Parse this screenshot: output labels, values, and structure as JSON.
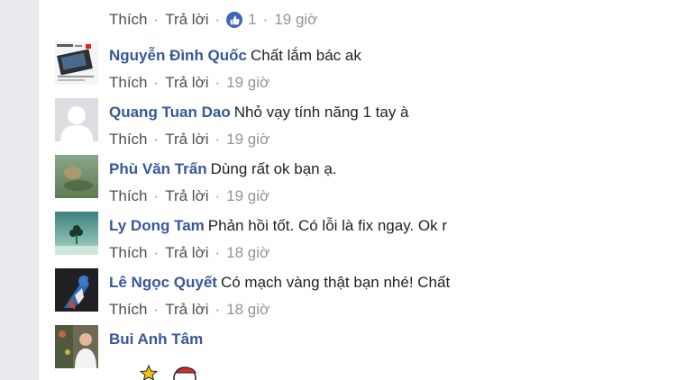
{
  "top": {
    "like_label": "Thích",
    "reply_label": "Trả lời",
    "like_count": "1",
    "time": "19 giờ"
  },
  "comments": [
    {
      "name": "Nguyễn Đình Quốc",
      "text": "Chất lắm bác ak",
      "like_label": "Thích",
      "reply_label": "Trả lời",
      "time": "19 giờ"
    },
    {
      "name": "Quang Tuan Dao",
      "text": "Nhỏ vạy tính năng 1 tay à",
      "like_label": "Thích",
      "reply_label": "Trả lời",
      "time": "19 giờ"
    },
    {
      "name": "Phù Văn Trấn",
      "text": "Dùng rất ok bạn ạ.",
      "like_label": "Thích",
      "reply_label": "Trả lời",
      "time": "19 giờ"
    },
    {
      "name": "Ly Dong Tam",
      "text": "Phản hồi tốt. Có lỗi là fix ngay. Ok r",
      "like_label": "Thích",
      "reply_label": "Trả lời",
      "time": "18 giờ"
    },
    {
      "name": "Lê Ngọc Quyết",
      "text": "Có mạch vàng thật bạn nhé! Chất",
      "like_label": "Thích",
      "reply_label": "Trả lời",
      "time": "18 giờ"
    },
    {
      "name": "Bui Anh Tâm",
      "text": ""
    }
  ],
  "icons": {
    "like": "thumbs-up-icon",
    "sticker": "sticker-icon"
  },
  "colors": {
    "name": "#365899",
    "meta": "#90949c",
    "like_bubble": "#4267b2"
  }
}
